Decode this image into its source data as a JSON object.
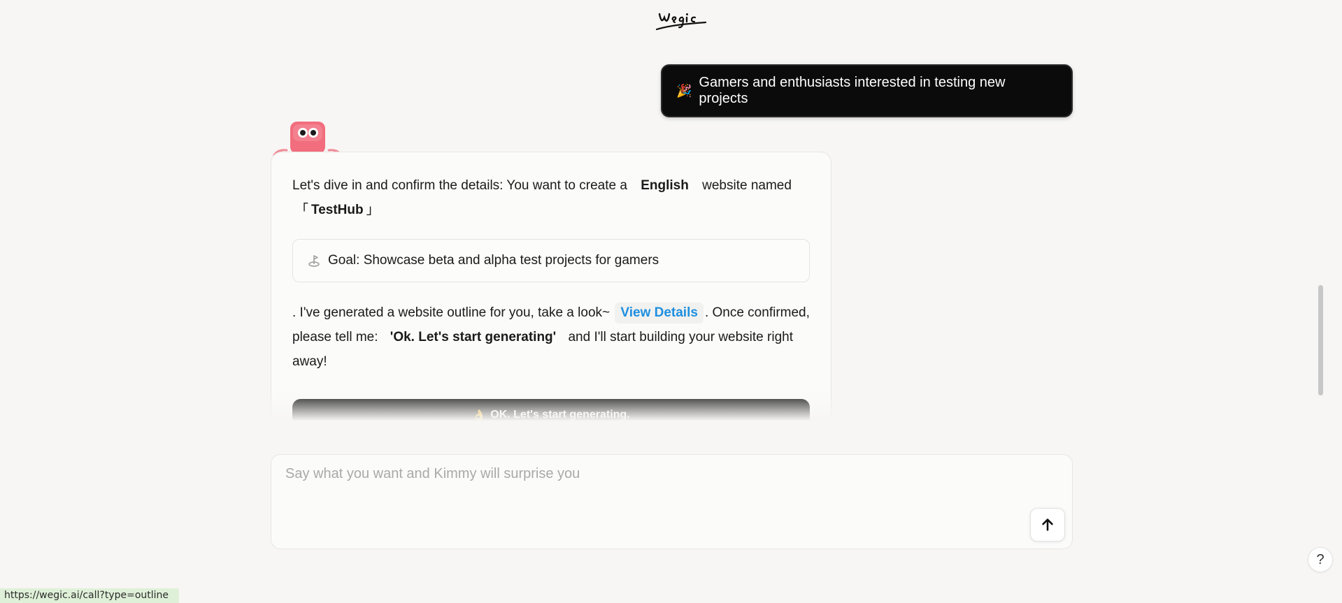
{
  "header": {
    "logo_text": "wegic"
  },
  "user_message": {
    "emoji": "🎉",
    "text": "Gamers and enthusiasts interested in testing new projects"
  },
  "assistant": {
    "intro_prefix": "Let's dive in and confirm the details: You want to create a",
    "language": "English",
    "intro_mid": "website named",
    "bracket_open": "「",
    "site_name": "TestHub",
    "bracket_close": "」",
    "goal_text": "Goal: Showcase beta and alpha test projects for gamers",
    "outline_prefix": ". I've generated a website outline for you, take a look~",
    "view_details_label": "View Details",
    "outline_mid": ". Once confirmed, please tell me:",
    "command_quote": "'Ok. Let's start generating'",
    "outline_suffix": "and I'll start building your website right away!",
    "cta_emoji": "👌",
    "cta_label": "OK. Let's start generating."
  },
  "composer": {
    "placeholder": "Say what you want and Kimmy will surprise you",
    "value": ""
  },
  "help": {
    "label": "?"
  },
  "status_bar": {
    "url": "https://wegic.ai/call?type=outline"
  },
  "colors": {
    "background": "#f7f6f4",
    "link": "#1e8fe0",
    "bubble": "#0b0b0b",
    "mascot": "#f26d7d"
  },
  "icons": [
    "wegic-logo",
    "party-popper-icon",
    "mascot-icon",
    "goal-icon",
    "ok-hand-icon",
    "arrow-up-icon",
    "help-icon"
  ]
}
